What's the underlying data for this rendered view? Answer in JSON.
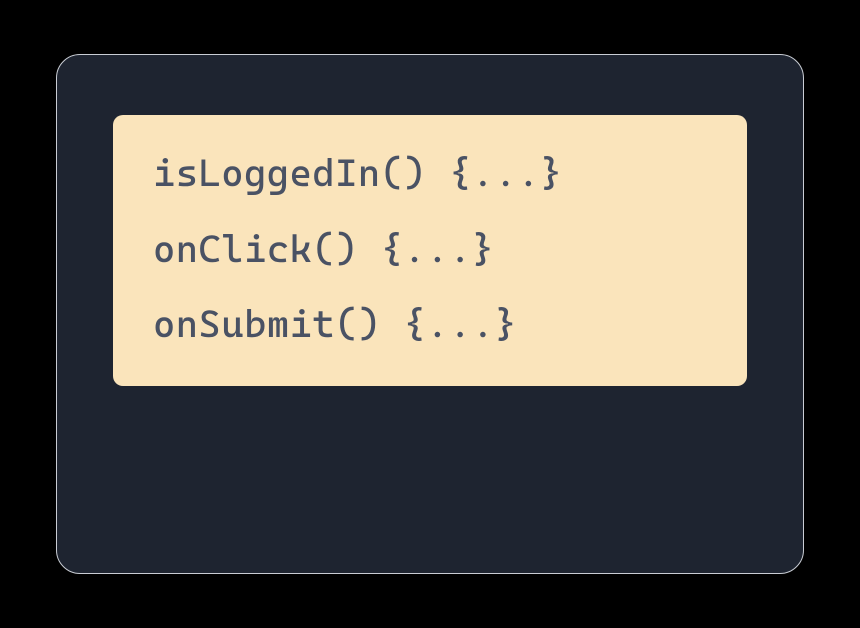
{
  "code": {
    "lines": [
      "isLoggedIn() {...}",
      "onClick() {...}",
      "onSubmit() {...}"
    ]
  },
  "colors": {
    "page_bg": "#000000",
    "panel_bg": "#1e2430",
    "panel_border": "#c9cdd4",
    "codebox_bg": "#fae4bb",
    "code_text": "#4a5264"
  }
}
